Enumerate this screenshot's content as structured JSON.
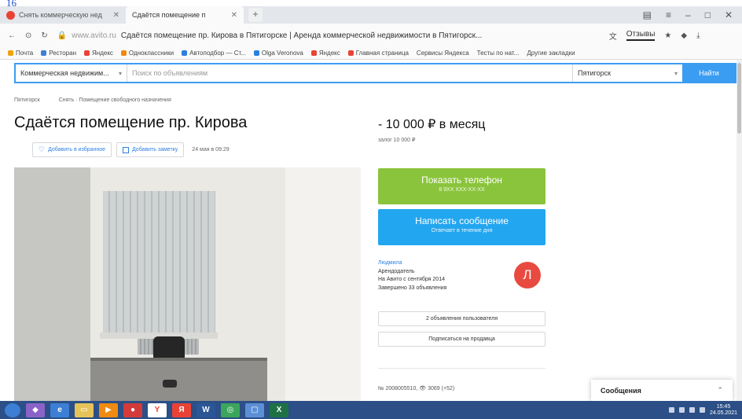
{
  "page_number": "16",
  "browser": {
    "tabs": [
      {
        "label": "Снять коммерческую нед",
        "active": false
      },
      {
        "label": "Сдаётся помещение п",
        "active": true
      }
    ],
    "address_host": "www.avito.ru",
    "page_title": "Сдаётся помещение пр. Кирова в Пятигорске | Аренда коммерческой недвижимости в Пятигорск...",
    "reviews_label": "Отзывы",
    "bookmarks": [
      "Почта",
      "Ресторан",
      "Яндекс",
      "Одноклассники",
      "Автоподбор — Ст...",
      "Olga Veronova",
      "Яндекс",
      "Главная страница",
      "Сервисы Яндекса",
      "Тесты по нат...",
      "Другие закладки"
    ]
  },
  "search": {
    "category": "Коммерческая недвижим...",
    "query_placeholder": "Поиск по объявлениям",
    "city": "Пятигорск",
    "submit_label": "Найти"
  },
  "breadcrumb": [
    "Пятигорск",
    "Снять · Помещение свободного назначения"
  ],
  "listing": {
    "title": "Сдаётся помещение пр. Кирова",
    "price": "- 10 000 ₽ в месяц",
    "deposit": "залог 10 000 ₽",
    "add_favorite_label": "Добавить в избранное",
    "add_note_label": "Добавить заметку",
    "date": "24 мая в 09:29",
    "watermark": "avito"
  },
  "contact": {
    "phone_label": "Показать телефон",
    "phone_sub": "8 9XX XXX-XX-XX",
    "message_label": "Написать сообщение",
    "message_sub": "Отвечает в течение дня"
  },
  "seller": {
    "name": "Людмила",
    "role": "Арендодатель",
    "since": "На Авито с сентября 2014",
    "completed": "Завершено 33 объявления",
    "avatar_letter": "Л",
    "listings_button": "2 объявления пользователя",
    "subscribe_button": "Подписаться на продавца"
  },
  "ad_meta": "№ 2008005510, 👁 3069 (+52)",
  "messages_label": "Сообщения",
  "taskbar": {
    "icons": [
      "folder",
      "media",
      "explorer",
      "files",
      "app",
      "browser-yandex",
      "Y",
      "Я",
      "W",
      "globe",
      "window",
      "X"
    ],
    "clock_time": "15:45",
    "clock_date": "24.05.2021"
  }
}
